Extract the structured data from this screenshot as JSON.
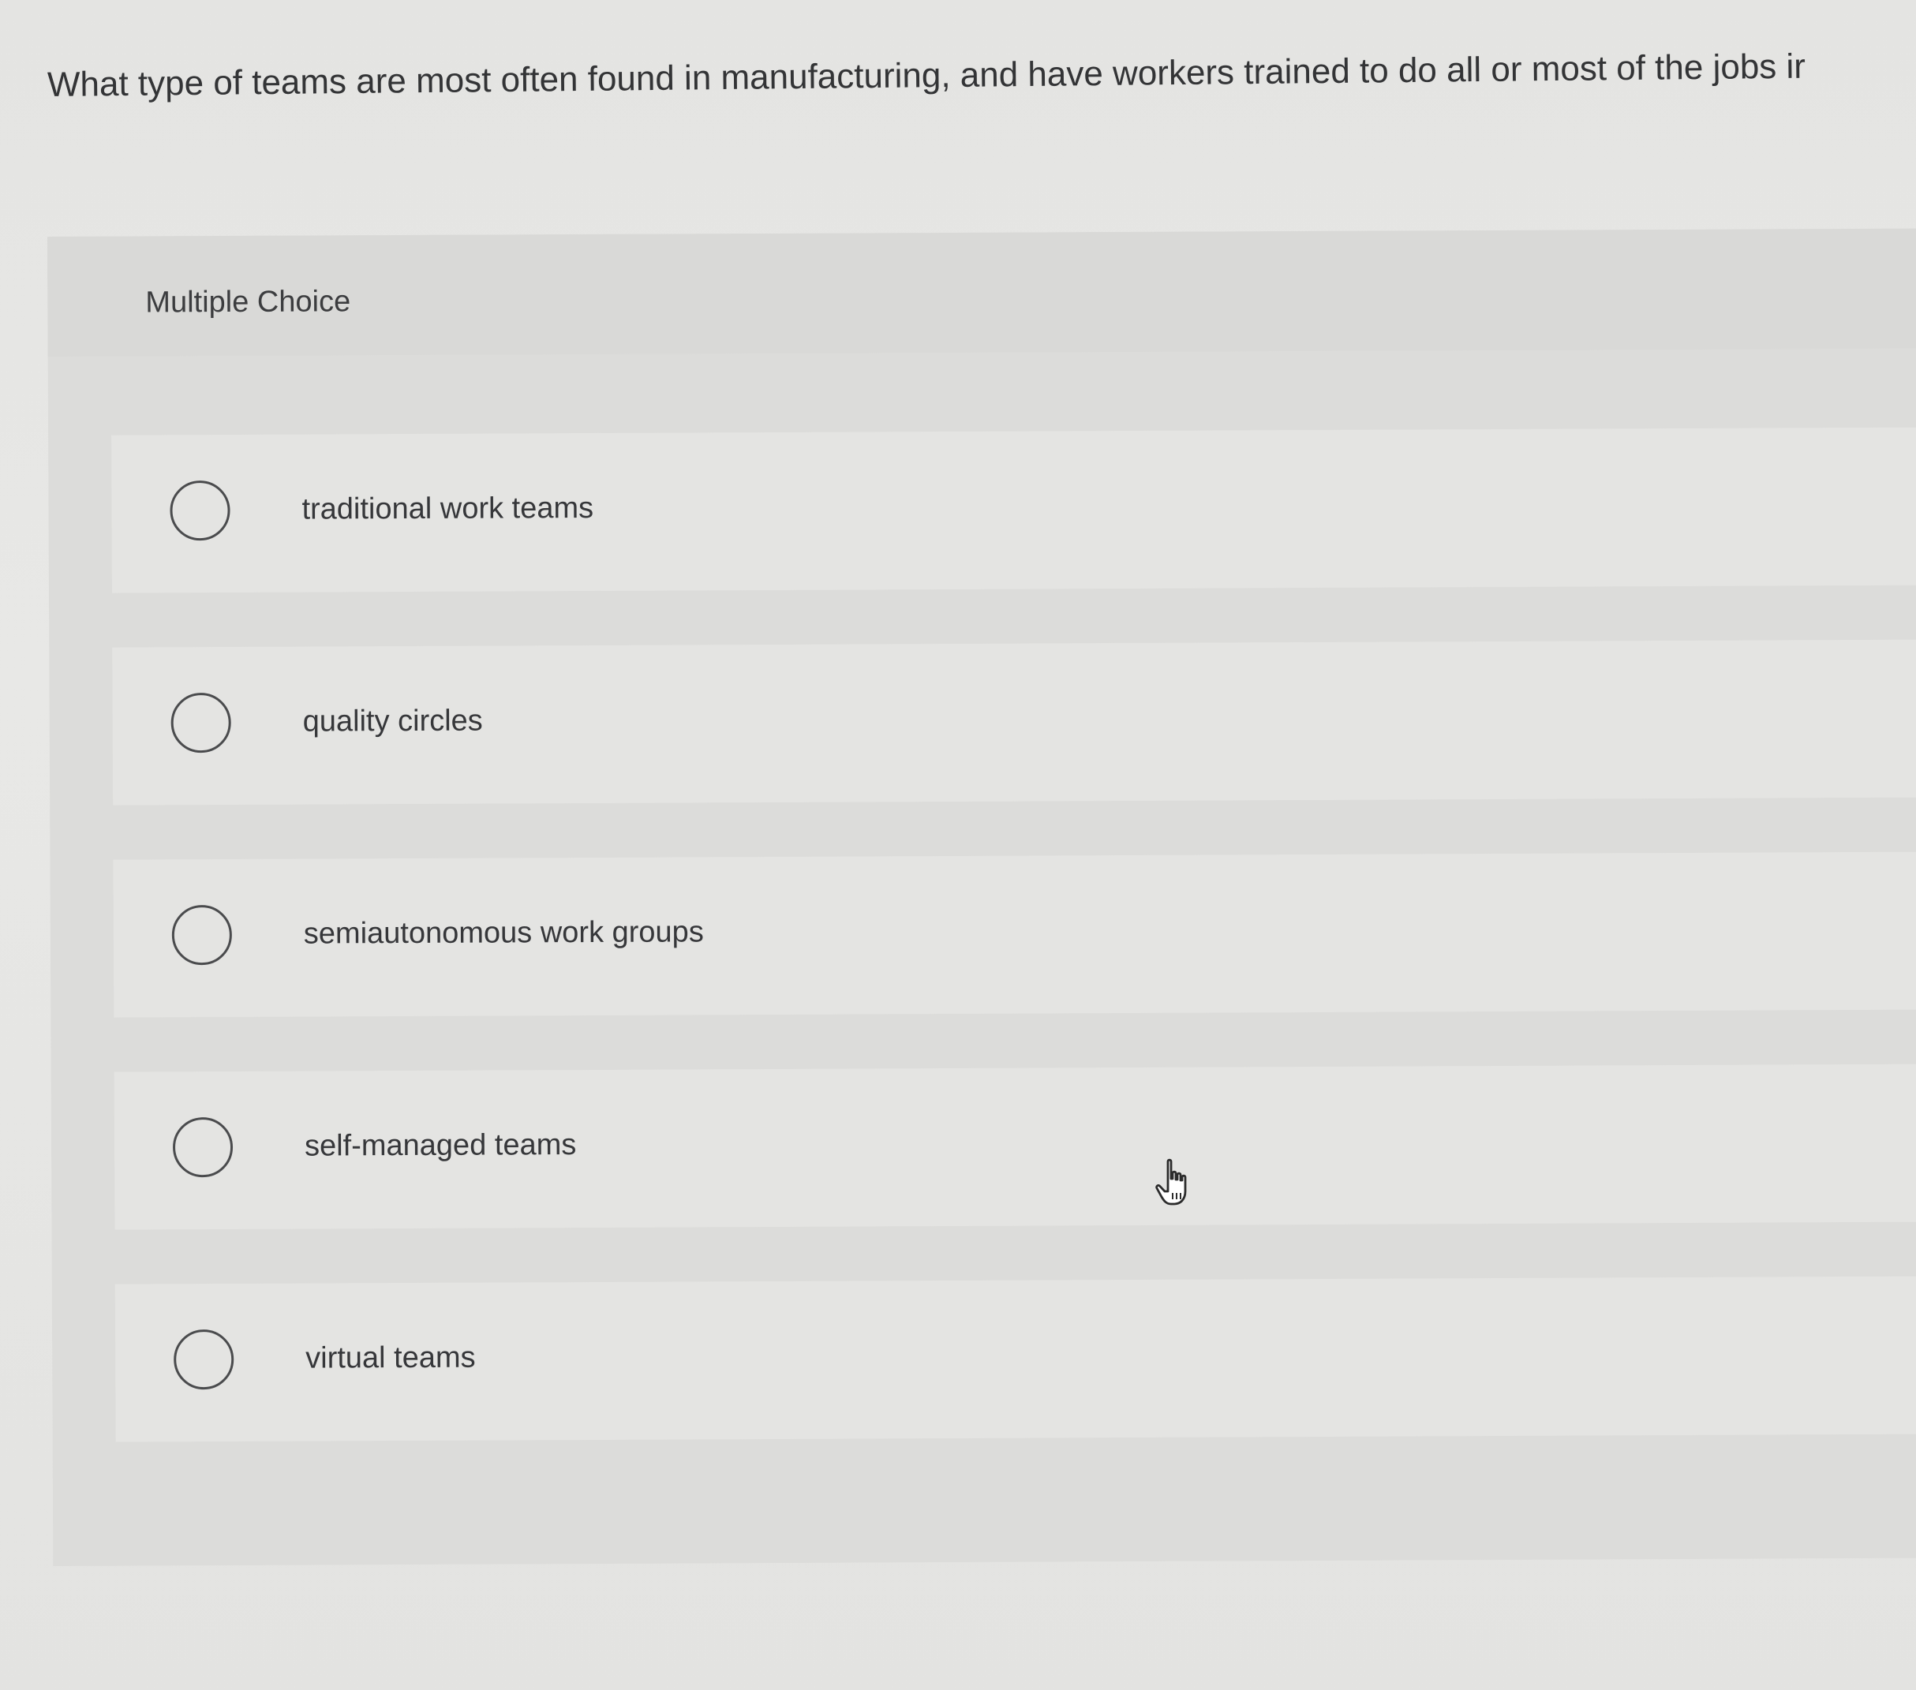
{
  "question": {
    "text": "What type of teams are most often found in manufacturing, and have workers trained to do all or most of the jobs ir"
  },
  "choice_panel": {
    "label": "Multiple Choice",
    "options": [
      {
        "label": "traditional work teams",
        "selected": false
      },
      {
        "label": "quality circles",
        "selected": false
      },
      {
        "label": "semiautonomous work groups",
        "selected": false
      },
      {
        "label": "self-managed teams",
        "selected": false
      },
      {
        "label": "virtual teams",
        "selected": false
      }
    ]
  },
  "cursor": {
    "icon": "pointer-hand-icon"
  },
  "colors": {
    "background": "#e4e4e2",
    "panel": "#dcdcda",
    "text": "#333436",
    "radio_border": "#4a4b4d"
  }
}
